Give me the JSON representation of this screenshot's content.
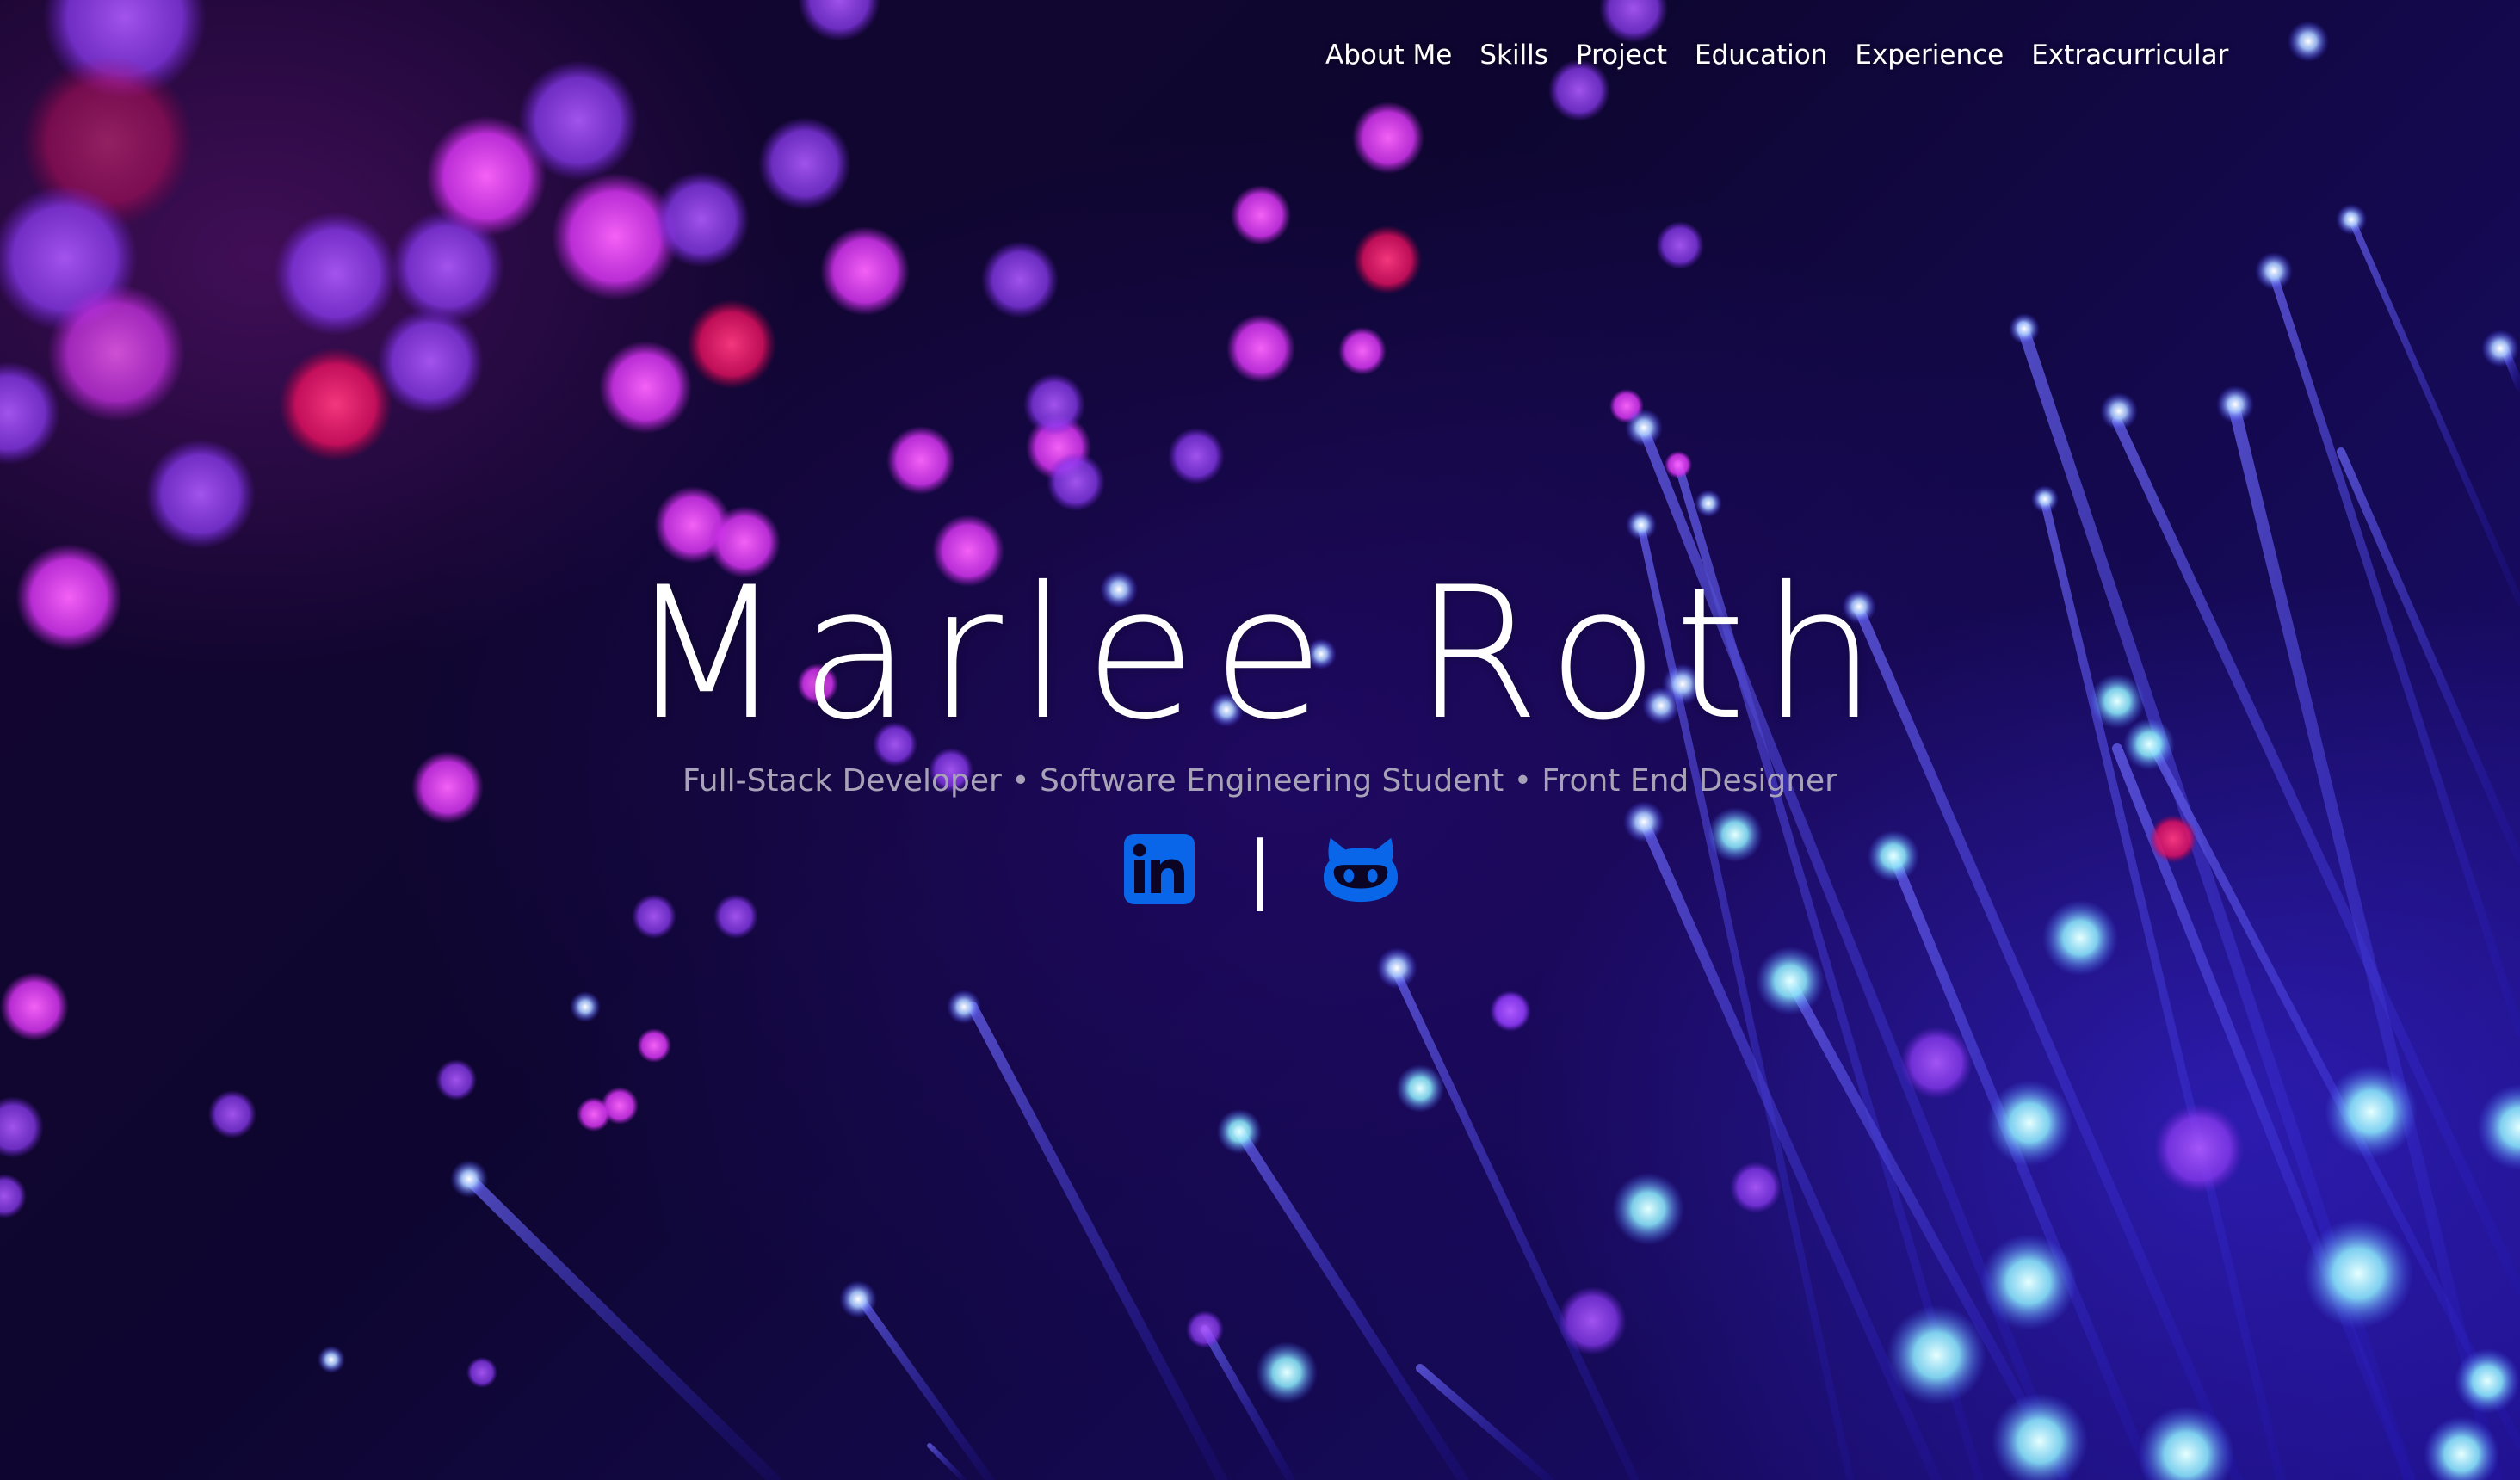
{
  "nav": {
    "items": [
      {
        "label": "About Me"
      },
      {
        "label": "Skills"
      },
      {
        "label": "Project"
      },
      {
        "label": "Education"
      },
      {
        "label": "Experience"
      },
      {
        "label": "Extracurricular"
      }
    ]
  },
  "hero": {
    "name": "Marlee Roth",
    "tagline": "Full-Stack Developer • Software Engineering Student • Front End Designer",
    "divider": "|"
  },
  "social": {
    "linkedin_icon": "linkedin-icon",
    "github_icon": "github-octocat-icon",
    "icon_color": "#0a66e8"
  },
  "colors": {
    "background_dark": "#0c0424",
    "fiber_blue": "#3b2cf5",
    "bokeh_pink": "#e83cff",
    "bokeh_red": "#ff1a66",
    "tagline_gray": "#a8a2b8"
  }
}
